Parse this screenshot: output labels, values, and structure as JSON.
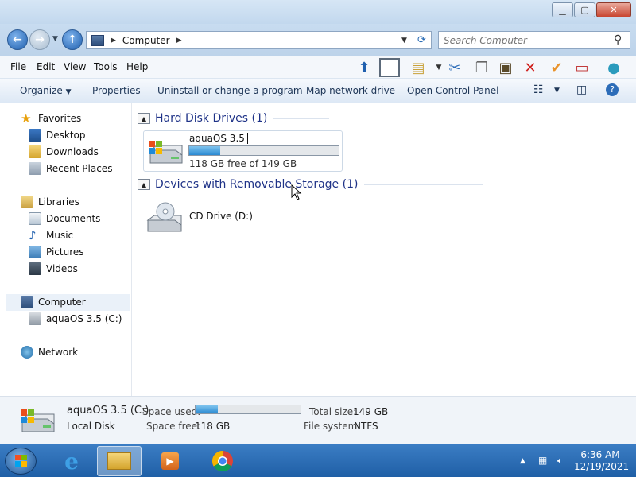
{
  "address": {
    "path": "Computer",
    "search_placeholder": "Search Computer"
  },
  "menu": [
    "File",
    "Edit",
    "View",
    "Tools",
    "Help"
  ],
  "commands": {
    "organize": "Organize",
    "properties": "Properties",
    "uninstall": "Uninstall or change a program",
    "map_drive": "Map network drive",
    "control_panel": "Open Control Panel"
  },
  "nav": {
    "favorites": "Favorites",
    "desktop": "Desktop",
    "downloads": "Downloads",
    "recent": "Recent Places",
    "libraries": "Libraries",
    "documents": "Documents",
    "music": "Music",
    "pictures": "Pictures",
    "videos": "Videos",
    "computer": "Computer",
    "drive_c": "aquaOS 3.5 (C:)",
    "network": "Network"
  },
  "content": {
    "hdd_header": "Hard Disk Drives (1)",
    "removable_header": "Devices with Removable Storage (1)",
    "drive_name": "aquaOS 3.5",
    "drive_free": "118 GB free of 149 GB",
    "drive_used_fraction": 0.21,
    "cd_label": "CD Drive (D:)"
  },
  "details": {
    "name": "aquaOS 3.5 (C:)",
    "type": "Local Disk",
    "space_used_label": "Space used:",
    "space_free_label": "Space free:",
    "space_free": "118 GB",
    "total_size_label": "Total size:",
    "total_size": "149 GB",
    "fs_label": "File system:",
    "fs": "NTFS",
    "used_fraction": 0.21
  },
  "taskbar": {
    "time": "6:36 AM",
    "date": "12/19/2021"
  },
  "colors": {
    "accent": "#1f5fae",
    "progress": "#2a8ad2",
    "header_text": "#1e3287"
  }
}
